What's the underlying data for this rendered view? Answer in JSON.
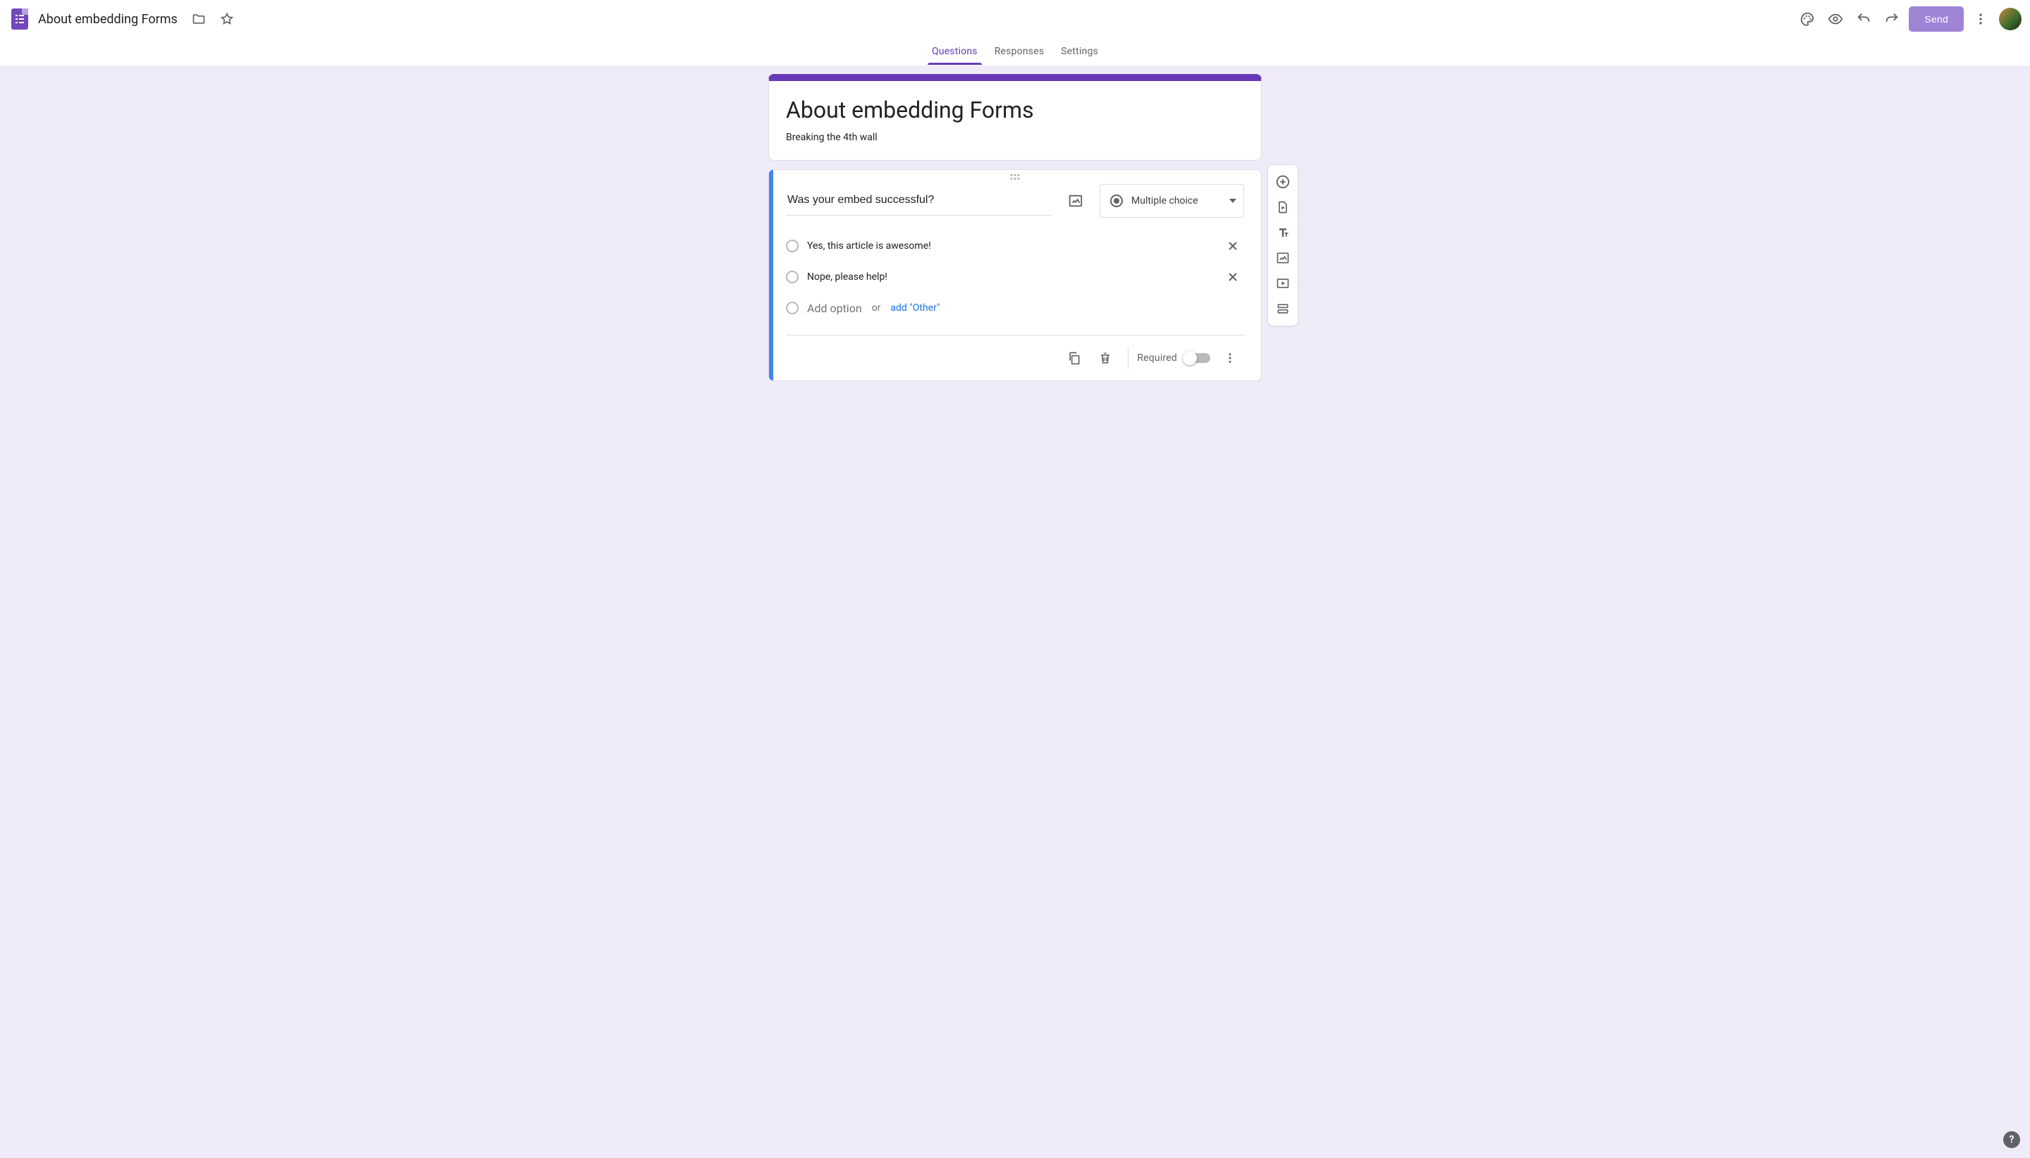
{
  "appbar": {
    "doc_title": "About embedding Forms",
    "send_label": "Send"
  },
  "tabs": {
    "questions": "Questions",
    "responses": "Responses",
    "settings": "Settings"
  },
  "form_header": {
    "title": "About embedding Forms",
    "description": "Breaking the 4th wall"
  },
  "question": {
    "title": "Was your embed successful?",
    "type_label": "Multiple choice",
    "options": [
      "Yes, this article is awesome!",
      "Nope, please help!"
    ],
    "add_option_placeholder": "Add option",
    "or_label": "or",
    "add_other_label": "add \"Other\"",
    "required_label": "Required"
  },
  "side_toolbar": {
    "add_question": "add-question",
    "import_questions": "import-questions",
    "add_title": "add-title",
    "add_image": "add-image",
    "add_video": "add-video",
    "add_section": "add-section"
  }
}
